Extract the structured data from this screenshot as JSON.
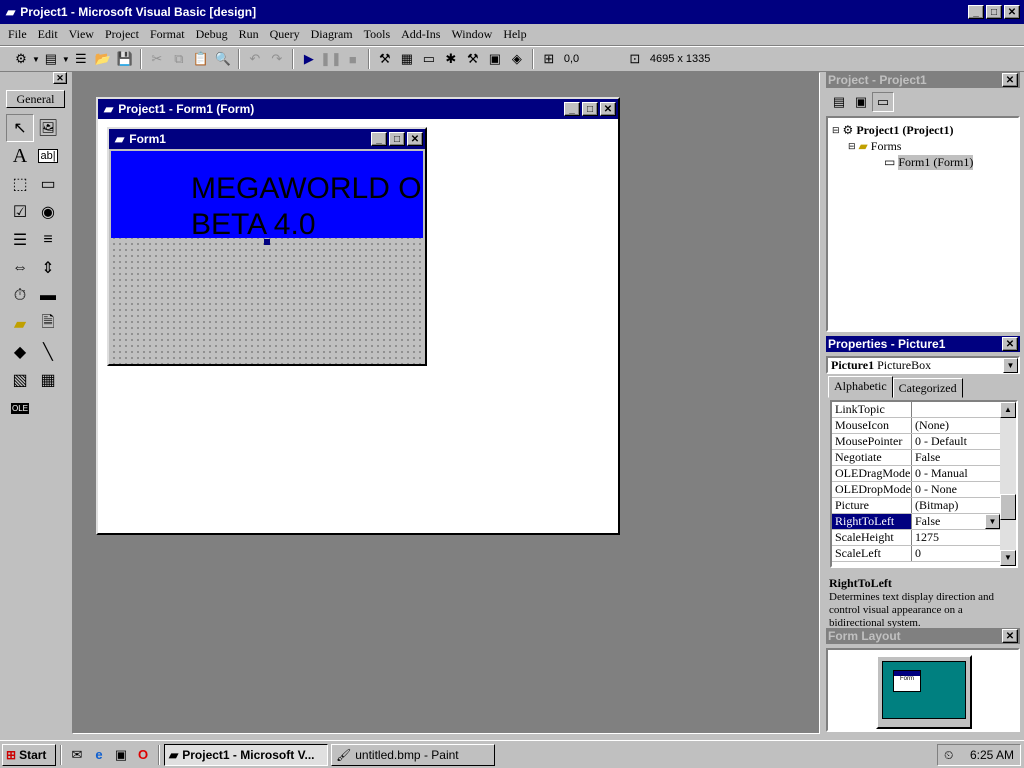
{
  "main_window": {
    "title": "Project1 - Microsoft Visual Basic [design]"
  },
  "menu": [
    "File",
    "Edit",
    "View",
    "Project",
    "Format",
    "Debug",
    "Run",
    "Query",
    "Diagram",
    "Tools",
    "Add-Ins",
    "Window",
    "Help"
  ],
  "toolbar": {
    "position": "0,0",
    "size": "4695 x 1335"
  },
  "toolbox": {
    "tab_label": "General",
    "tools": [
      "pointer-icon",
      "picturebox-icon",
      "label-icon",
      "textbox-icon",
      "frame-icon",
      "commandbutton-icon",
      "checkbox-icon",
      "optionbutton-icon",
      "combobox-icon",
      "listbox-icon",
      "hscrollbar-icon",
      "vscrollbar-icon",
      "timer-icon",
      "drivelistbox-icon",
      "dirlistbox-icon",
      "filelistbox-icon",
      "shape-icon",
      "line-icon",
      "image-icon",
      "data-icon",
      "ole-icon"
    ],
    "ole_label": "OLE",
    "textbox_label": "ab|"
  },
  "designer": {
    "title": "Project1 - Form1 (Form)"
  },
  "form1": {
    "title": "Form1",
    "picture_text": "MEGAWORLD O\nBETA 4.0"
  },
  "project": {
    "title": "Project - Project1",
    "tree": [
      {
        "label": "Project1 (Project1)",
        "bold": true
      },
      {
        "label": "Forms"
      },
      {
        "label": "Form1 (Form1)"
      }
    ]
  },
  "properties": {
    "title": "Properties - Picture1",
    "object_name": "Picture1",
    "object_type": "PictureBox",
    "tabs": [
      "Alphabetic",
      "Categorized"
    ],
    "rows": [
      {
        "name": "LinkTopic",
        "value": ""
      },
      {
        "name": "MouseIcon",
        "value": "(None)"
      },
      {
        "name": "MousePointer",
        "value": "0 - Default"
      },
      {
        "name": "Negotiate",
        "value": "False"
      },
      {
        "name": "OLEDragMode",
        "value": "0 - Manual"
      },
      {
        "name": "OLEDropMode",
        "value": "0 - None"
      },
      {
        "name": "Picture",
        "value": "(Bitmap)"
      },
      {
        "name": "RightToLeft",
        "value": "False"
      },
      {
        "name": "ScaleHeight",
        "value": "1275"
      },
      {
        "name": "ScaleLeft",
        "value": "0"
      }
    ],
    "desc_name": "RightToLeft",
    "desc_text": "Determines text display direction and control visual appearance on a bidirectional system."
  },
  "form_layout": {
    "title": "Form Layout",
    "mini_form_label": "Form"
  },
  "taskbar": {
    "start": "Start",
    "tasks": [
      "Project1 - Microsoft V...",
      "untitled.bmp - Paint"
    ],
    "time": "6:25 AM"
  }
}
